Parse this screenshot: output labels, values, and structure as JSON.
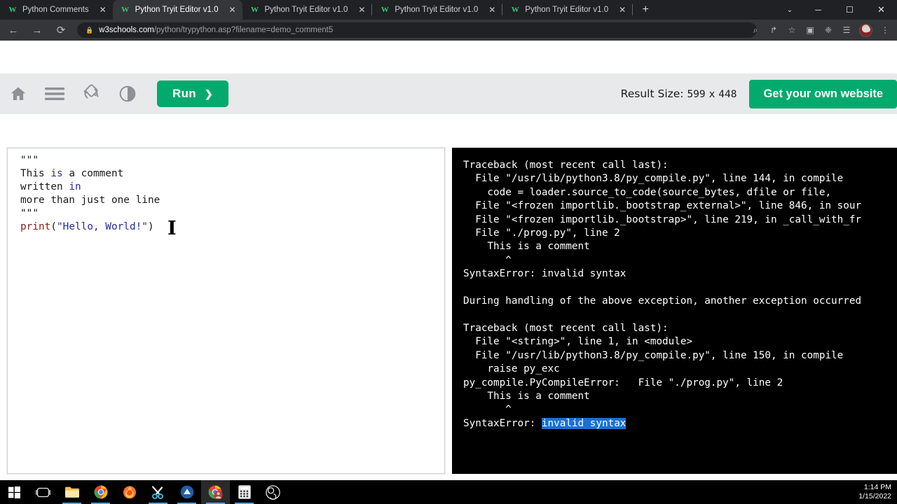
{
  "browser": {
    "tabs": [
      {
        "title": "Python Comments",
        "active": false
      },
      {
        "title": "Python Tryit Editor v1.0",
        "active": true
      },
      {
        "title": "Python Tryit Editor v1.0",
        "active": false
      },
      {
        "title": "Python Tryit Editor v1.0",
        "active": false
      },
      {
        "title": "Python Tryit Editor v1.0",
        "active": false
      }
    ],
    "favicon_text": "W",
    "new_tab_label": "+",
    "tab_close_label": "✕",
    "window": {
      "caret": "⌄",
      "minimize": "─",
      "maximize": "☐",
      "close": "✕"
    },
    "nav": {
      "back": "←",
      "forward": "→",
      "reload": "⟳"
    },
    "omnibox": {
      "lock": "🔒",
      "host": "w3schools.com",
      "path": "/python/trypython.asp?filename=demo_comment5"
    },
    "actions": {
      "search": "⌕",
      "share": "↱",
      "bookmark": "☆",
      "payment": "▣",
      "extensions": "❈",
      "readinglist": "☰",
      "menu": "⋮"
    }
  },
  "toolbar": {
    "home_icon": "home-icon",
    "menu_icon": "hamburger-icon",
    "rotate_icon": "rotate-screen-icon",
    "contrast_icon": "dark-mode-icon",
    "run_label": "Run",
    "run_chevron": "❯",
    "result_size_label": "Result Size:",
    "result_width": "599",
    "result_times": "x",
    "result_height": "448",
    "get_website_label": "Get your own website"
  },
  "editor": {
    "lines": [
      {
        "segments": [
          {
            "t": "\"\"\"",
            "c": "plain"
          }
        ]
      },
      {
        "segments": [
          {
            "t": "This ",
            "c": "plain"
          },
          {
            "t": "is",
            "c": "kw"
          },
          {
            "t": " a comment",
            "c": "plain"
          }
        ]
      },
      {
        "segments": [
          {
            "t": "written ",
            "c": "plain"
          },
          {
            "t": "in",
            "c": "kw"
          }
        ]
      },
      {
        "segments": [
          {
            "t": "more than just one line",
            "c": "plain"
          }
        ]
      },
      {
        "segments": [
          {
            "t": "\"\"\"",
            "c": "plain"
          }
        ]
      },
      {
        "segments": [
          {
            "t": "print",
            "c": "fn"
          },
          {
            "t": "(",
            "c": "plain"
          },
          {
            "t": "\"Hello, World!\"",
            "c": "str"
          },
          {
            "t": ")",
            "c": "plain"
          }
        ]
      }
    ]
  },
  "output": {
    "lines": [
      {
        "text": "Traceback (most recent call last):"
      },
      {
        "text": "  File \"/usr/lib/python3.8/py_compile.py\", line 144, in compile"
      },
      {
        "text": "    code = loader.source_to_code(source_bytes, dfile or file,"
      },
      {
        "text": "  File \"<frozen importlib._bootstrap_external>\", line 846, in sour"
      },
      {
        "text": "  File \"<frozen importlib._bootstrap>\", line 219, in _call_with_fr"
      },
      {
        "text": "  File \"./prog.py\", line 2"
      },
      {
        "text": "    This is a comment"
      },
      {
        "text": "       ^"
      },
      {
        "text": "SyntaxError: invalid syntax"
      },
      {
        "text": ""
      },
      {
        "text": "During handling of the above exception, another exception occurred"
      },
      {
        "text": ""
      },
      {
        "text": "Traceback (most recent call last):"
      },
      {
        "text": "  File \"<string>\", line 1, in <module>"
      },
      {
        "text": "  File \"/usr/lib/python3.8/py_compile.py\", line 150, in compile"
      },
      {
        "text": "    raise py_exc"
      },
      {
        "text": "py_compile.PyCompileError:   File \"./prog.py\", line 2"
      },
      {
        "text": "    This is a comment"
      },
      {
        "text": "       ^"
      },
      {
        "text": "SyntaxError: ",
        "highlight": "invalid syntax"
      }
    ],
    "scrollbar": {
      "left_arrow": "◀",
      "right_arrow": "▶",
      "thumb_percent": "81"
    }
  },
  "cursor": {
    "glyph": "I"
  },
  "taskbar": {
    "items": [
      {
        "name": "start-button",
        "icon": "windows-logo",
        "active": false,
        "running": false
      },
      {
        "name": "task-view-button",
        "icon": "task-view",
        "active": false,
        "running": false
      },
      {
        "name": "file-explorer",
        "icon": "folder",
        "active": false,
        "running": true
      },
      {
        "name": "chrome",
        "icon": "chrome",
        "active": false,
        "running": true
      },
      {
        "name": "firefox",
        "icon": "firefox",
        "active": false,
        "running": false
      },
      {
        "name": "snip-and-sketch",
        "icon": "snip",
        "active": false,
        "running": true
      },
      {
        "name": "blue-app",
        "icon": "blue-chevron",
        "active": false,
        "running": true
      },
      {
        "name": "chrome-active",
        "icon": "chrome-person",
        "active": true,
        "running": true
      },
      {
        "name": "calculator",
        "icon": "calculator",
        "active": false,
        "running": true
      },
      {
        "name": "obs-studio",
        "icon": "obs",
        "active": false,
        "running": false
      }
    ],
    "clock": {
      "time": "1:14 PM",
      "date": "1/15/2022"
    }
  },
  "colors": {
    "accent_green": "#04aa6d",
    "chrome_dark": "#202124",
    "chrome_tab_active": "#35363a",
    "toolbar_gray": "#e7e9eb",
    "selection_blue": "#1f6fd0",
    "keyword_blue": "#2929a3",
    "function_red": "#8b2020"
  }
}
